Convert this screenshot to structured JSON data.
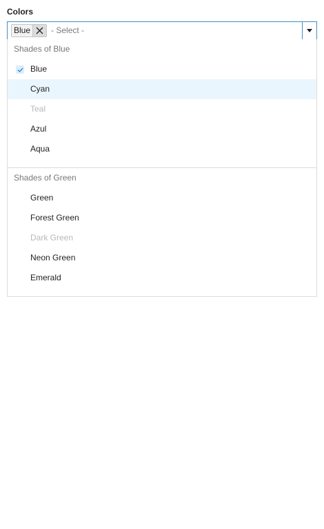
{
  "field": {
    "label": "Colors"
  },
  "combo": {
    "selected_chip": "Blue",
    "placeholder": "- Select -"
  },
  "groups": [
    {
      "header": "Shades of Blue",
      "options": [
        {
          "label": "Blue",
          "selected": true
        },
        {
          "label": "Cyan",
          "highlighted": true
        },
        {
          "label": "Teal",
          "disabled": true
        },
        {
          "label": "Azul"
        },
        {
          "label": "Aqua"
        }
      ]
    },
    {
      "header": "Shades of Green",
      "options": [
        {
          "label": "Green"
        },
        {
          "label": "Forest Green"
        },
        {
          "label": "Dark Green",
          "disabled": true
        },
        {
          "label": "Neon Green"
        },
        {
          "label": "Emerald"
        }
      ]
    }
  ],
  "icons": {
    "remove": "close-icon",
    "toggle": "caret-down-icon",
    "check": "check-icon"
  },
  "colors": {
    "accent_border": "#3d8fc7",
    "hover_background": "#eaf6fd",
    "disabled_text": "#b8b8b8",
    "group_header_text": "#777777"
  }
}
